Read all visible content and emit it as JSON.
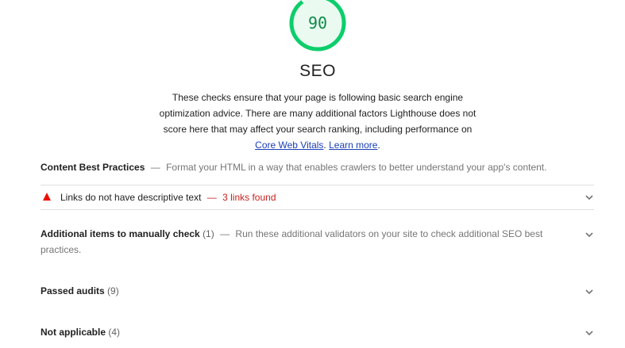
{
  "score": {
    "value": "90",
    "fraction": 0.9,
    "color": "#0cce6b"
  },
  "category": {
    "title": "SEO",
    "description_text": "These checks ensure that your page is following basic search engine optimization advice. There are many additional factors Lighthouse does not score here that may affect your search ranking, including performance on",
    "link1": "Core Web Vitals",
    "link1_suffix": ".",
    "link2": "Learn more",
    "link2_suffix": "."
  },
  "group": {
    "title": "Content Best Practices",
    "dash": "—",
    "description": "Format your HTML in a way that enables crawlers to better understand your app's content."
  },
  "audit": {
    "title": "Links do not have descriptive text",
    "dash": "—",
    "display_value": "3 links found",
    "status_color": "#eb0f00"
  },
  "clumps": {
    "manual": {
      "title": "Additional items to manually check",
      "count": "(1)",
      "dash": "—",
      "description": "Run these additional validators on your site to check additional SEO best practices."
    },
    "passed": {
      "title": "Passed audits",
      "count": "(9)"
    },
    "not_applicable": {
      "title": "Not applicable",
      "count": "(4)"
    }
  },
  "icons": {
    "fail": "triangle-warning-icon",
    "expand": "chevron-down-icon"
  }
}
